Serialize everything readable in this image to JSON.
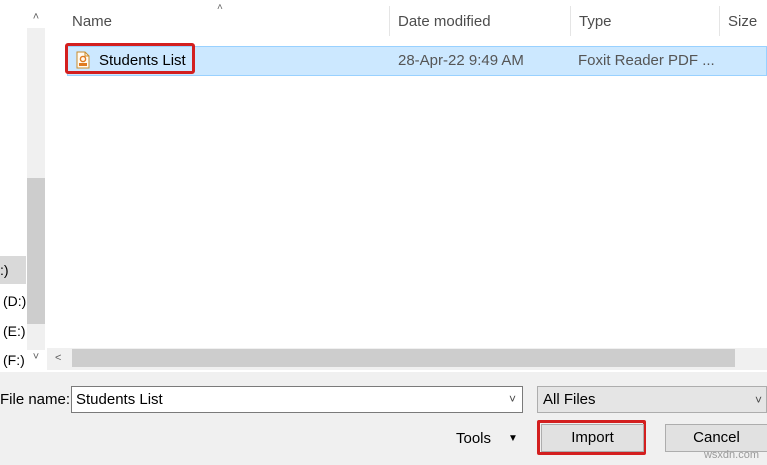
{
  "nav": {
    "drives": [
      {
        "label": ":)",
        "selected": true
      },
      {
        "label": "(D:)",
        "selected": false
      },
      {
        "label": "(E:)",
        "selected": false
      },
      {
        "label": "(F:)",
        "selected": false
      }
    ],
    "expand_icon": "chevron-down-icon",
    "scroll_up_icon": "chevron-up-icon"
  },
  "columns": {
    "name": "Name",
    "date": "Date modified",
    "type": "Type",
    "size": "Size"
  },
  "files": [
    {
      "name": "Students List",
      "date": "28-Apr-22 9:49 AM",
      "type": "Foxit Reader PDF ...",
      "icon": "pdf-file-icon"
    }
  ],
  "bottom": {
    "filename_label": "File name:",
    "filename_value": "Students List",
    "filetype_value": "All Files",
    "tools_label": "Tools",
    "import_label": "Import",
    "cancel_label": "Cancel"
  },
  "watermark": "wsxdn.com",
  "colors": {
    "selection": "#cce8ff",
    "highlight": "#d31f1f"
  }
}
